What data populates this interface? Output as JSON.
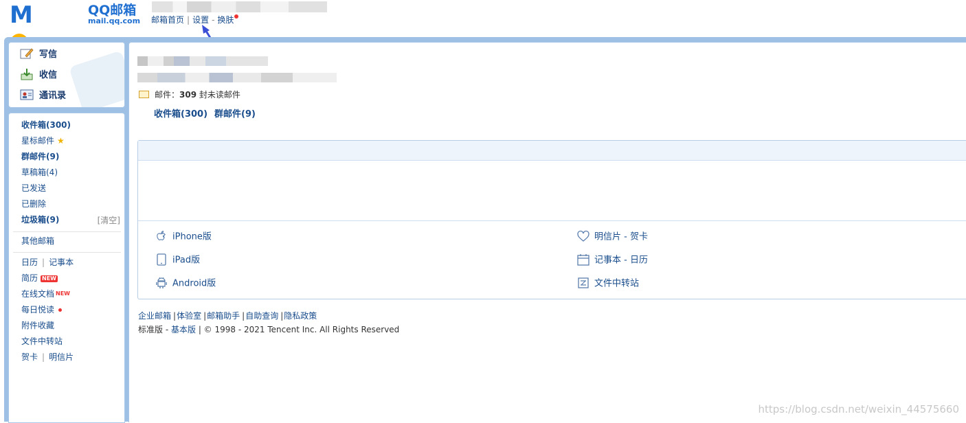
{
  "header": {
    "brand": "QQ邮箱",
    "domain": "mail.qq.com",
    "links": [
      "邮箱首页",
      "设置",
      "换肤"
    ],
    "sep_pipe": "|",
    "sep_dash": "-"
  },
  "sidebar": {
    "compose": "写信",
    "receive": "收信",
    "contacts": "通讯录",
    "inbox": "收件箱(300)",
    "starred": "星标邮件",
    "group": "群邮件(9)",
    "drafts": "草稿箱(4)",
    "sent": "已发送",
    "deleted": "已删除",
    "spam": "垃圾箱(9)",
    "clear": "[清空]",
    "other": "其他邮箱",
    "calendar": "日历",
    "notebook": "记事本",
    "resume": "简历",
    "new_badge": "NEW",
    "docs": "在线文档",
    "daily": "每日悦读",
    "attachments": "附件收藏",
    "transfer": "文件中转站",
    "greeting_card": "贺卡",
    "postcard": "明信片",
    "pipe": "|"
  },
  "main": {
    "unread_prefix": "邮件：",
    "unread_count": "309",
    "unread_suffix": "封未读邮件",
    "inbox_link": "收件箱(300)",
    "group_link": "群邮件(9)",
    "apps": {
      "iphone": "iPhone版",
      "ipad": "iPad版",
      "android": "Android版",
      "cards": "明信片 - 贺卡",
      "notes": "记事本 - 日历",
      "transfer": "文件中转站"
    },
    "footer_links": [
      "企业邮箱",
      "体验室",
      "邮箱助手",
      "自助查询",
      "隐私政策"
    ],
    "footer_std": "标准版",
    "footer_dash": " - ",
    "footer_basic": "基本版",
    "footer_copy": " | © 1998 - 2021 Tencent Inc. All Rights Reserved"
  },
  "watermark": "https://blog.csdn.net/weixin_44575660",
  "colors": {
    "accent": "#1a4d8c",
    "frame": "#9dc0e4",
    "arrow": "#3a4fd6"
  }
}
